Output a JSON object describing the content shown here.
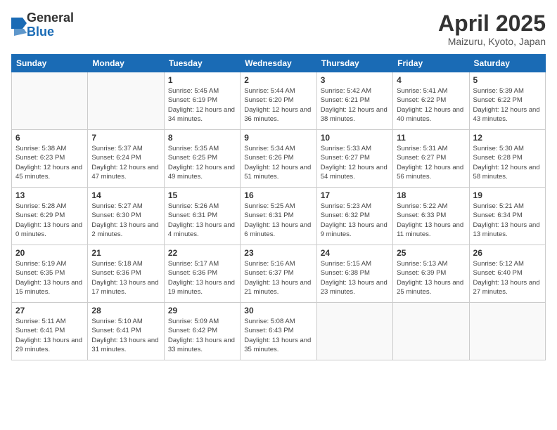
{
  "header": {
    "logo_general": "General",
    "logo_blue": "Blue",
    "month_title": "April 2025",
    "location": "Maizuru, Kyoto, Japan"
  },
  "days_of_week": [
    "Sunday",
    "Monday",
    "Tuesday",
    "Wednesday",
    "Thursday",
    "Friday",
    "Saturday"
  ],
  "weeks": [
    [
      {
        "day": "",
        "sunrise": "",
        "sunset": "",
        "daylight": ""
      },
      {
        "day": "",
        "sunrise": "",
        "sunset": "",
        "daylight": ""
      },
      {
        "day": "1",
        "sunrise": "Sunrise: 5:45 AM",
        "sunset": "Sunset: 6:19 PM",
        "daylight": "Daylight: 12 hours and 34 minutes."
      },
      {
        "day": "2",
        "sunrise": "Sunrise: 5:44 AM",
        "sunset": "Sunset: 6:20 PM",
        "daylight": "Daylight: 12 hours and 36 minutes."
      },
      {
        "day": "3",
        "sunrise": "Sunrise: 5:42 AM",
        "sunset": "Sunset: 6:21 PM",
        "daylight": "Daylight: 12 hours and 38 minutes."
      },
      {
        "day": "4",
        "sunrise": "Sunrise: 5:41 AM",
        "sunset": "Sunset: 6:22 PM",
        "daylight": "Daylight: 12 hours and 40 minutes."
      },
      {
        "day": "5",
        "sunrise": "Sunrise: 5:39 AM",
        "sunset": "Sunset: 6:22 PM",
        "daylight": "Daylight: 12 hours and 43 minutes."
      }
    ],
    [
      {
        "day": "6",
        "sunrise": "Sunrise: 5:38 AM",
        "sunset": "Sunset: 6:23 PM",
        "daylight": "Daylight: 12 hours and 45 minutes."
      },
      {
        "day": "7",
        "sunrise": "Sunrise: 5:37 AM",
        "sunset": "Sunset: 6:24 PM",
        "daylight": "Daylight: 12 hours and 47 minutes."
      },
      {
        "day": "8",
        "sunrise": "Sunrise: 5:35 AM",
        "sunset": "Sunset: 6:25 PM",
        "daylight": "Daylight: 12 hours and 49 minutes."
      },
      {
        "day": "9",
        "sunrise": "Sunrise: 5:34 AM",
        "sunset": "Sunset: 6:26 PM",
        "daylight": "Daylight: 12 hours and 51 minutes."
      },
      {
        "day": "10",
        "sunrise": "Sunrise: 5:33 AM",
        "sunset": "Sunset: 6:27 PM",
        "daylight": "Daylight: 12 hours and 54 minutes."
      },
      {
        "day": "11",
        "sunrise": "Sunrise: 5:31 AM",
        "sunset": "Sunset: 6:27 PM",
        "daylight": "Daylight: 12 hours and 56 minutes."
      },
      {
        "day": "12",
        "sunrise": "Sunrise: 5:30 AM",
        "sunset": "Sunset: 6:28 PM",
        "daylight": "Daylight: 12 hours and 58 minutes."
      }
    ],
    [
      {
        "day": "13",
        "sunrise": "Sunrise: 5:28 AM",
        "sunset": "Sunset: 6:29 PM",
        "daylight": "Daylight: 13 hours and 0 minutes."
      },
      {
        "day": "14",
        "sunrise": "Sunrise: 5:27 AM",
        "sunset": "Sunset: 6:30 PM",
        "daylight": "Daylight: 13 hours and 2 minutes."
      },
      {
        "day": "15",
        "sunrise": "Sunrise: 5:26 AM",
        "sunset": "Sunset: 6:31 PM",
        "daylight": "Daylight: 13 hours and 4 minutes."
      },
      {
        "day": "16",
        "sunrise": "Sunrise: 5:25 AM",
        "sunset": "Sunset: 6:31 PM",
        "daylight": "Daylight: 13 hours and 6 minutes."
      },
      {
        "day": "17",
        "sunrise": "Sunrise: 5:23 AM",
        "sunset": "Sunset: 6:32 PM",
        "daylight": "Daylight: 13 hours and 9 minutes."
      },
      {
        "day": "18",
        "sunrise": "Sunrise: 5:22 AM",
        "sunset": "Sunset: 6:33 PM",
        "daylight": "Daylight: 13 hours and 11 minutes."
      },
      {
        "day": "19",
        "sunrise": "Sunrise: 5:21 AM",
        "sunset": "Sunset: 6:34 PM",
        "daylight": "Daylight: 13 hours and 13 minutes."
      }
    ],
    [
      {
        "day": "20",
        "sunrise": "Sunrise: 5:19 AM",
        "sunset": "Sunset: 6:35 PM",
        "daylight": "Daylight: 13 hours and 15 minutes."
      },
      {
        "day": "21",
        "sunrise": "Sunrise: 5:18 AM",
        "sunset": "Sunset: 6:36 PM",
        "daylight": "Daylight: 13 hours and 17 minutes."
      },
      {
        "day": "22",
        "sunrise": "Sunrise: 5:17 AM",
        "sunset": "Sunset: 6:36 PM",
        "daylight": "Daylight: 13 hours and 19 minutes."
      },
      {
        "day": "23",
        "sunrise": "Sunrise: 5:16 AM",
        "sunset": "Sunset: 6:37 PM",
        "daylight": "Daylight: 13 hours and 21 minutes."
      },
      {
        "day": "24",
        "sunrise": "Sunrise: 5:15 AM",
        "sunset": "Sunset: 6:38 PM",
        "daylight": "Daylight: 13 hours and 23 minutes."
      },
      {
        "day": "25",
        "sunrise": "Sunrise: 5:13 AM",
        "sunset": "Sunset: 6:39 PM",
        "daylight": "Daylight: 13 hours and 25 minutes."
      },
      {
        "day": "26",
        "sunrise": "Sunrise: 5:12 AM",
        "sunset": "Sunset: 6:40 PM",
        "daylight": "Daylight: 13 hours and 27 minutes."
      }
    ],
    [
      {
        "day": "27",
        "sunrise": "Sunrise: 5:11 AM",
        "sunset": "Sunset: 6:41 PM",
        "daylight": "Daylight: 13 hours and 29 minutes."
      },
      {
        "day": "28",
        "sunrise": "Sunrise: 5:10 AM",
        "sunset": "Sunset: 6:41 PM",
        "daylight": "Daylight: 13 hours and 31 minutes."
      },
      {
        "day": "29",
        "sunrise": "Sunrise: 5:09 AM",
        "sunset": "Sunset: 6:42 PM",
        "daylight": "Daylight: 13 hours and 33 minutes."
      },
      {
        "day": "30",
        "sunrise": "Sunrise: 5:08 AM",
        "sunset": "Sunset: 6:43 PM",
        "daylight": "Daylight: 13 hours and 35 minutes."
      },
      {
        "day": "",
        "sunrise": "",
        "sunset": "",
        "daylight": ""
      },
      {
        "day": "",
        "sunrise": "",
        "sunset": "",
        "daylight": ""
      },
      {
        "day": "",
        "sunrise": "",
        "sunset": "",
        "daylight": ""
      }
    ]
  ]
}
